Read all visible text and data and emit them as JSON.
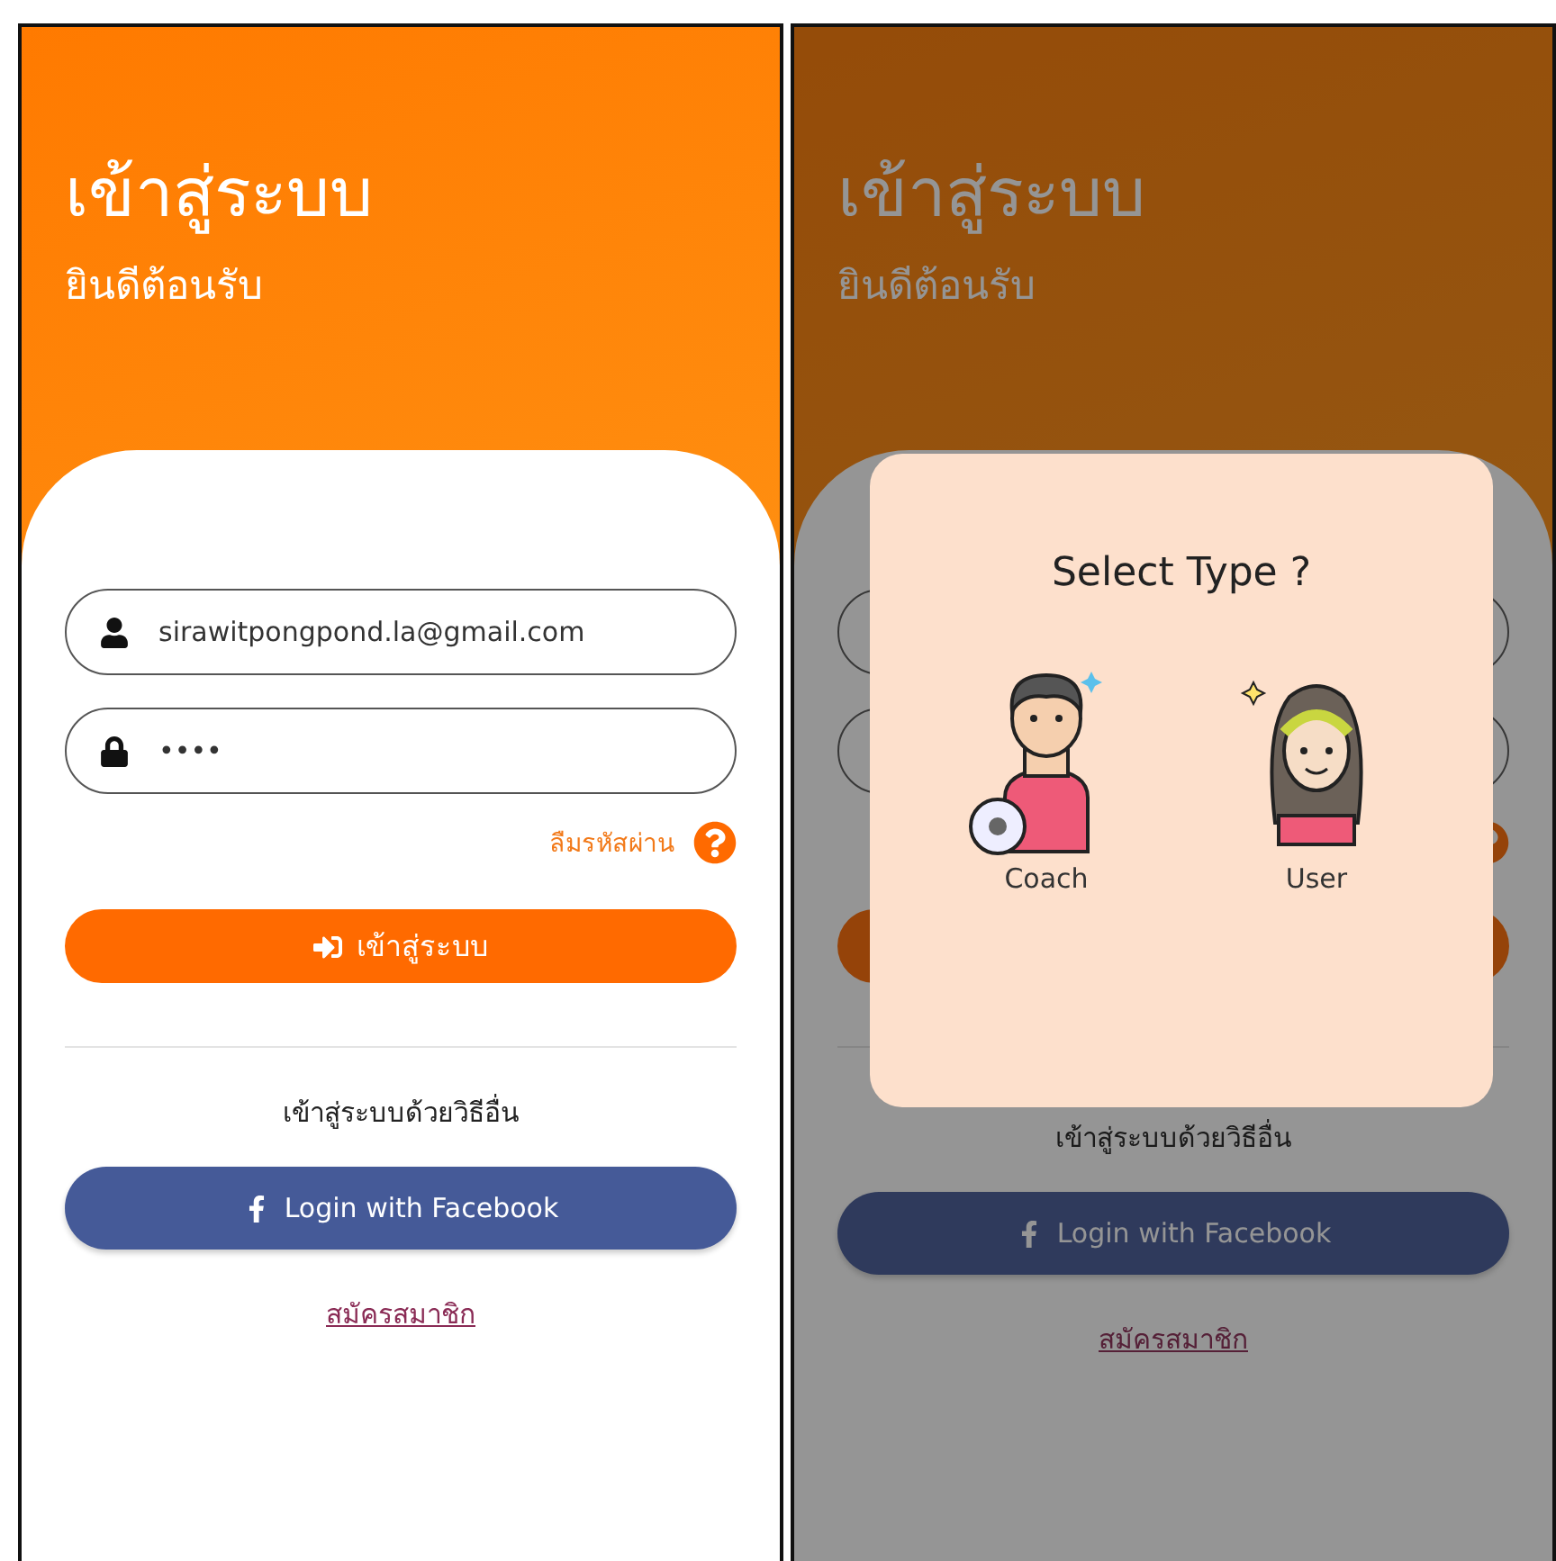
{
  "screens": [
    {
      "title": "เข้าสู่ระบบ",
      "subtitle": "ยินดีต้อนรับ",
      "fields": [
        {
          "kind": "email",
          "value": "sirawitpongpond.la@gmail.com"
        },
        {
          "kind": "password",
          "value": "••••"
        }
      ],
      "forgot_password": "ลืมรหัสผ่าน",
      "login_button": "เข้าสู่ระบบ",
      "other_methods": "เข้าสู่ระบบด้วยวิธีอื่น",
      "facebook_button": "Login with Facebook",
      "signup_link": "สมัครสมาชิก"
    },
    {
      "title": "เข้าสู่ระบบ",
      "subtitle": "ยินดีต้อนรับ",
      "other_methods": "เข้าสู่ระบบด้วยวิธีอื่น",
      "facebook_button": "Login with Facebook",
      "signup_link": "สมัครสมาชิก",
      "dialog": {
        "title": "Select Type ?",
        "options": [
          {
            "kind": "coach",
            "label": "Coach"
          },
          {
            "kind": "user",
            "label": "User"
          }
        ]
      }
    }
  ]
}
